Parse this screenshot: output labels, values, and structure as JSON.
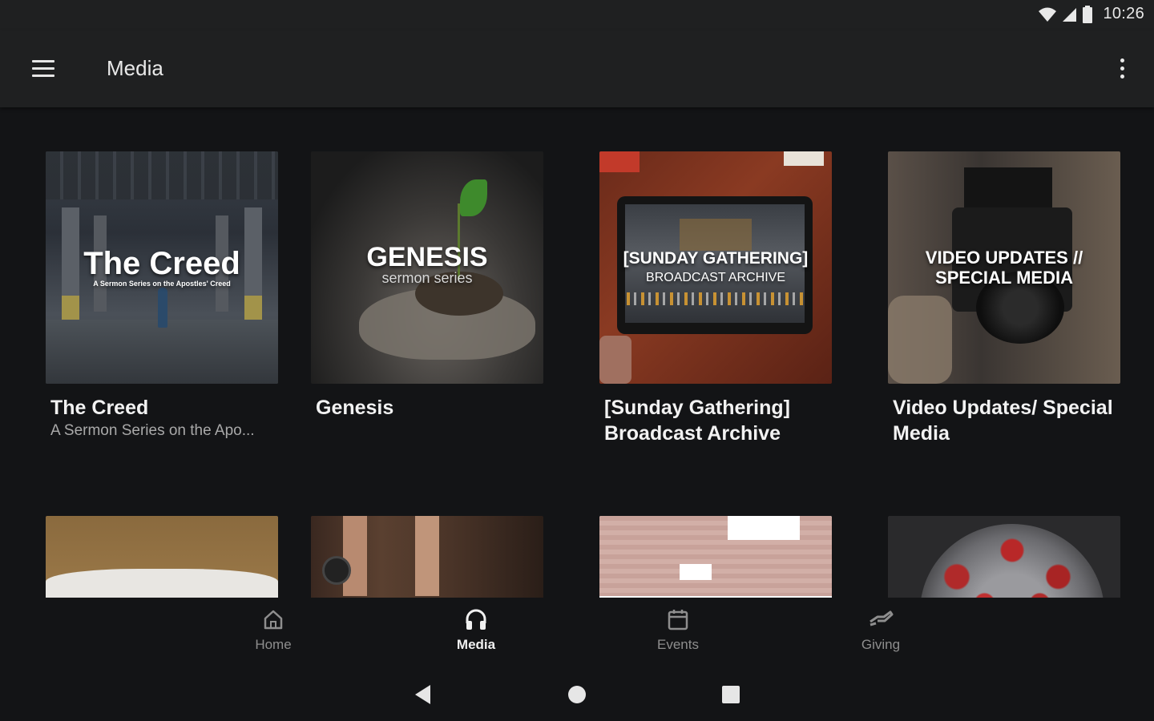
{
  "status": {
    "time": "10:26"
  },
  "app_bar": {
    "title": "Media"
  },
  "cards": [
    {
      "title": "The Creed",
      "subtitle": "A Sermon Series on the Apo...",
      "art_title": "The Creed",
      "art_sub": "A Sermon Series on the Apostles' Creed"
    },
    {
      "title": "Genesis",
      "subtitle": "",
      "art_title": "GENESIS",
      "art_sub": "sermon series"
    },
    {
      "title": "[Sunday Gathering] Broadcast Archive",
      "subtitle": "",
      "art_title": "[SUNDAY GATHERING]",
      "art_sub": "BROADCAST ARCHIVE"
    },
    {
      "title": "Video Updates/ Special Media",
      "subtitle": "",
      "art_title": "VIDEO UPDATES //",
      "art_sub": "SPECIAL MEDIA"
    }
  ],
  "nav": {
    "items": [
      {
        "label": "Home",
        "icon": "home-icon"
      },
      {
        "label": "Media",
        "icon": "headphones-icon"
      },
      {
        "label": "Events",
        "icon": "calendar-icon"
      },
      {
        "label": "Giving",
        "icon": "giving-hand-icon"
      }
    ],
    "active": "Media"
  },
  "colors": {
    "background": "#131416",
    "app_bar": "#1f2021",
    "accent_active": "#f0f0f0",
    "inactive": "#8e8e8e"
  }
}
